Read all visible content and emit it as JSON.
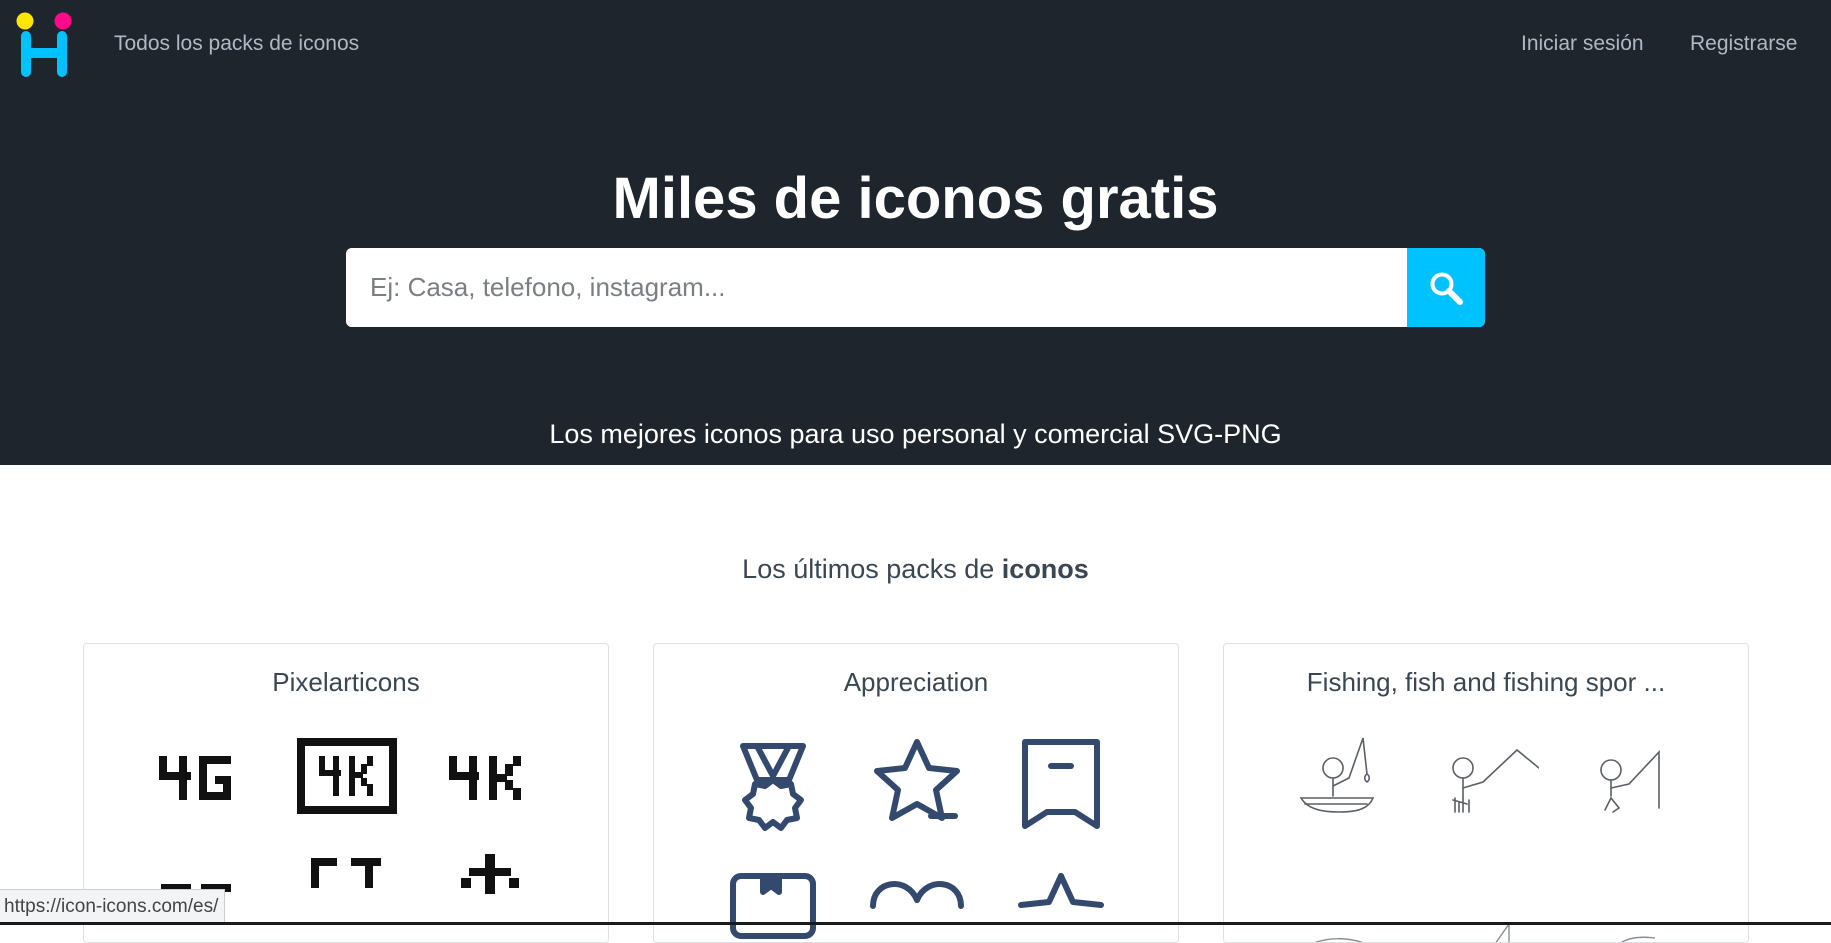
{
  "header": {
    "nav_all_packs": "Todos los packs de iconos",
    "login": "Iniciar sesión",
    "register": "Registrarse",
    "logo_icon": "icon-icons-logo",
    "colors": {
      "background": "#1f252d",
      "nav_text": "#aeb9c6",
      "accent": "#00c2ff",
      "logo_yellow": "#ffe600",
      "logo_pink": "#ff0a8a"
    }
  },
  "hero": {
    "title": "Miles de iconos gratis",
    "search_placeholder": "Ej: Casa, telefono, instagram...",
    "search_icon": "magnifier-icon",
    "subtitle": "Los mejores iconos para uso personal y comercial SVG-PNG"
  },
  "section": {
    "title_prefix": "Los últimos packs de ",
    "title_bold": "iconos"
  },
  "packs": [
    {
      "title": "Pixelarticons",
      "icons": [
        "4g-icon",
        "4k-box-icon",
        "4k-icon",
        "pixel-icon",
        "pixel-icon",
        "pixel-snowflake-icon"
      ]
    },
    {
      "title": "Appreciation",
      "icons": [
        "medal-icon",
        "star-minus-icon",
        "bookmark-minus-icon",
        "bookmark-box-icon",
        "heart-icon",
        "star-icon"
      ]
    },
    {
      "title": "Fishing, fish and fishing spor ...",
      "icons": [
        "fishing-boat-icon",
        "fisherman-icon",
        "fisherman-rod-icon"
      ]
    }
  ],
  "status_bar": {
    "url": "https://icon-icons.com/es/"
  }
}
